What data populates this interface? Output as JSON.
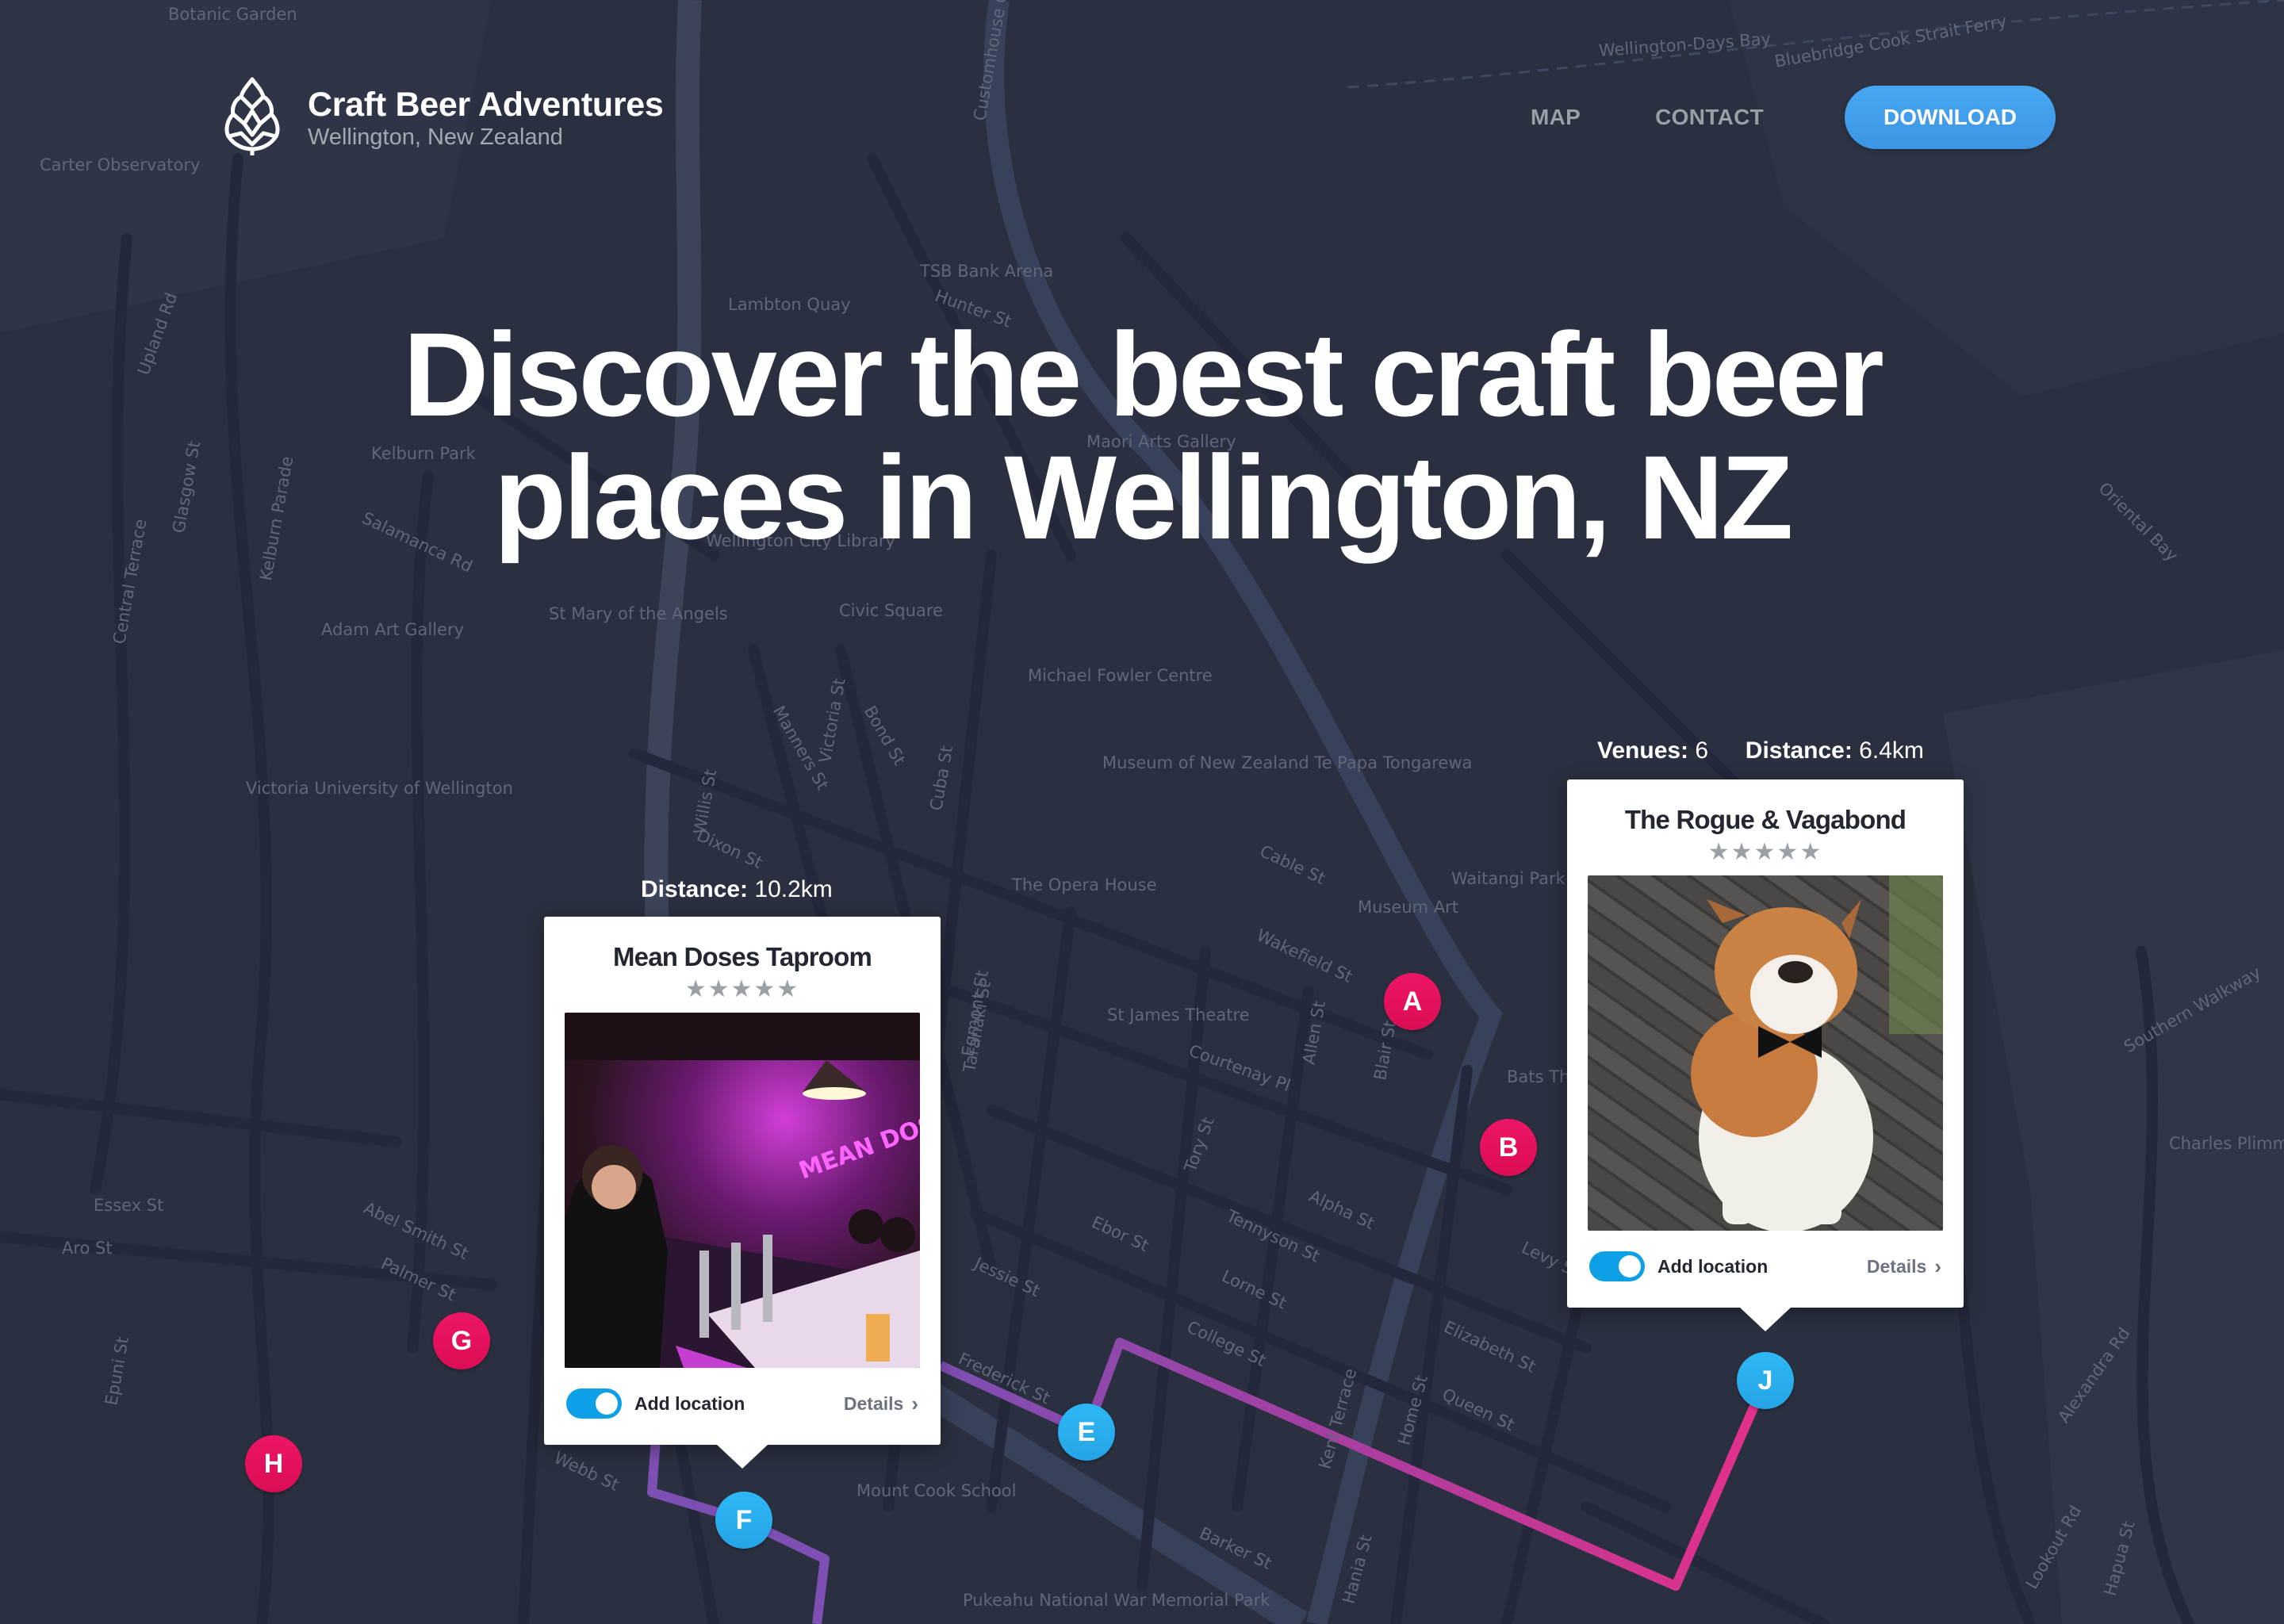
{
  "header": {
    "brand_title": "Craft Beer Adventures",
    "brand_subtitle": "Wellington, New Zealand",
    "logo_icon": "hop-cone-icon",
    "nav": [
      {
        "label": "MAP"
      },
      {
        "label": "CONTACT"
      }
    ],
    "download_label": "DOWNLOAD"
  },
  "hero": {
    "line1": "Discover the best craft beer",
    "line2": "places in Wellington, NZ"
  },
  "colors": {
    "background": "#2b3040",
    "accent_blue": "#3d9ee9",
    "marker_pink": "#e8115f",
    "marker_blue": "#2bb3f2",
    "route_start": "#7e4fb3",
    "route_end": "#e4308a"
  },
  "route_summary": {
    "venues_label": "Venues:",
    "venues_value": "6",
    "distance_label": "Distance:",
    "distance_value": "6.4km"
  },
  "cards": [
    {
      "caption_label": "Distance:",
      "caption_value": "10.2km",
      "title": "Mean Doses Taproom",
      "stars": "★★★★★",
      "rating": 0,
      "image_alt": "Bartender pouring beer in pink neon-lit taproom",
      "neon_sign": "MEAN DOSES",
      "toggle_label": "Add location",
      "toggle_on": true,
      "details_label": "Details",
      "chevron": "›"
    },
    {
      "title": "The Rogue & Vagabond",
      "stars": "★★★★★",
      "rating": 0,
      "image_alt": "Bulldog wearing a bow tie on brick pavement",
      "toggle_label": "Add location",
      "toggle_on": true,
      "details_label": "Details",
      "chevron": "›"
    }
  ],
  "markers": [
    {
      "letter": "A",
      "type": "pink"
    },
    {
      "letter": "B",
      "type": "pink"
    },
    {
      "letter": "G",
      "type": "pink"
    },
    {
      "letter": "H",
      "type": "pink"
    },
    {
      "letter": "E",
      "type": "blue"
    },
    {
      "letter": "F",
      "type": "blue"
    },
    {
      "letter": "J",
      "type": "blue"
    }
  ],
  "map_labels": [
    "Botanic Garden",
    "Carter Observatory",
    "Lambton Quay",
    "TSB Bank Arena",
    "Hunter St",
    "Kelburn Park",
    "Maori Arts Gallery",
    "Wellington City Library",
    "Salamanca Rd",
    "Adam Art Gallery",
    "St Mary of the Angels",
    "Civic Square",
    "Michael Fowler Centre",
    "Victoria University of Wellington",
    "Museum of New Zealand Te Papa Tongarewa",
    "Cable St",
    "The Opera House",
    "Waitangi Park",
    "Museum Art",
    "Wakefield St",
    "St James Theatre",
    "Courtenay Pl",
    "Bats Theatre",
    "Essex St",
    "Aro St",
    "Abel Smith St",
    "Palmer St",
    "Frederick St",
    "Jessie St",
    "Ebor St",
    "Tory St",
    "Alpha St",
    "Tennyson St",
    "Lorne St",
    "College St",
    "Elizabeth St",
    "Queen St",
    "Kent Terrace",
    "Home St",
    "Hania St",
    "Barker St",
    "Mount Cook School",
    "Pukeahu National War Memorial Park",
    "Wellington-Days Bay",
    "Bluebridge Cook Strait Ferry",
    "Oriental Bay",
    "Southern Walkway",
    "Charles Plimmer",
    "Alexandra Rd",
    "Lookout Rd",
    "Hapua St",
    "Willis St",
    "Victoria St",
    "Cuba St",
    "Dixon St",
    "Taranaki St",
    "Customhouse Quay",
    "Glasgow St",
    "Kelburn Parade",
    "Upland Rd",
    "Central Terrace",
    "Epuni St",
    "Webb St",
    "Levy St",
    "Blair St",
    "Allen St",
    "Egmont St",
    "Manners St",
    "Bond St"
  ]
}
